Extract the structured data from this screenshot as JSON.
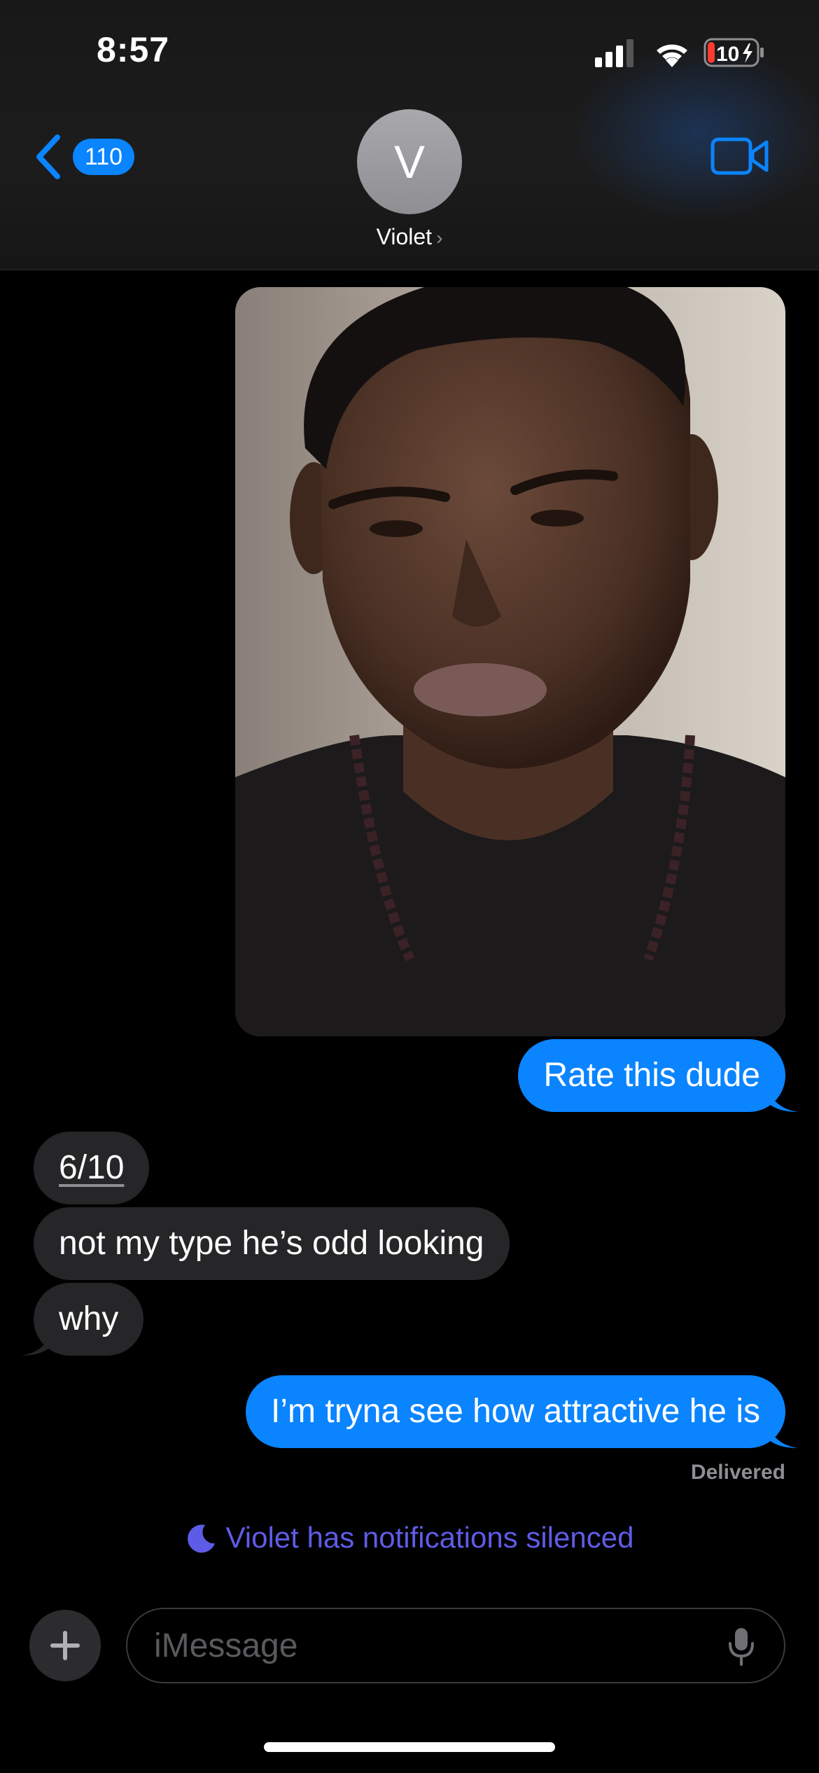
{
  "status_bar": {
    "time": "8:57",
    "battery": "10"
  },
  "header": {
    "back_badge": "110",
    "avatar_initial": "V",
    "contact_name": "Violet",
    "name_chevron": "›"
  },
  "messages": [
    {
      "side": "outgoing",
      "type": "image",
      "description": "portrait photo"
    },
    {
      "side": "outgoing",
      "text": "Rate this dude"
    },
    {
      "side": "incoming",
      "text": "6/10"
    },
    {
      "side": "incoming",
      "text": "not my type he’s odd looking"
    },
    {
      "side": "incoming",
      "text": "why"
    },
    {
      "side": "outgoing",
      "text": "I’m tryna see how attractive he is"
    }
  ],
  "delivered_label": "Delivered",
  "silenced_notice": "Violet has notifications silenced",
  "composer": {
    "placeholder": "iMessage"
  },
  "colors": {
    "accent": "#0a84ff",
    "incoming_bubble": "#262628",
    "focus_purple": "#5e5ce6"
  }
}
